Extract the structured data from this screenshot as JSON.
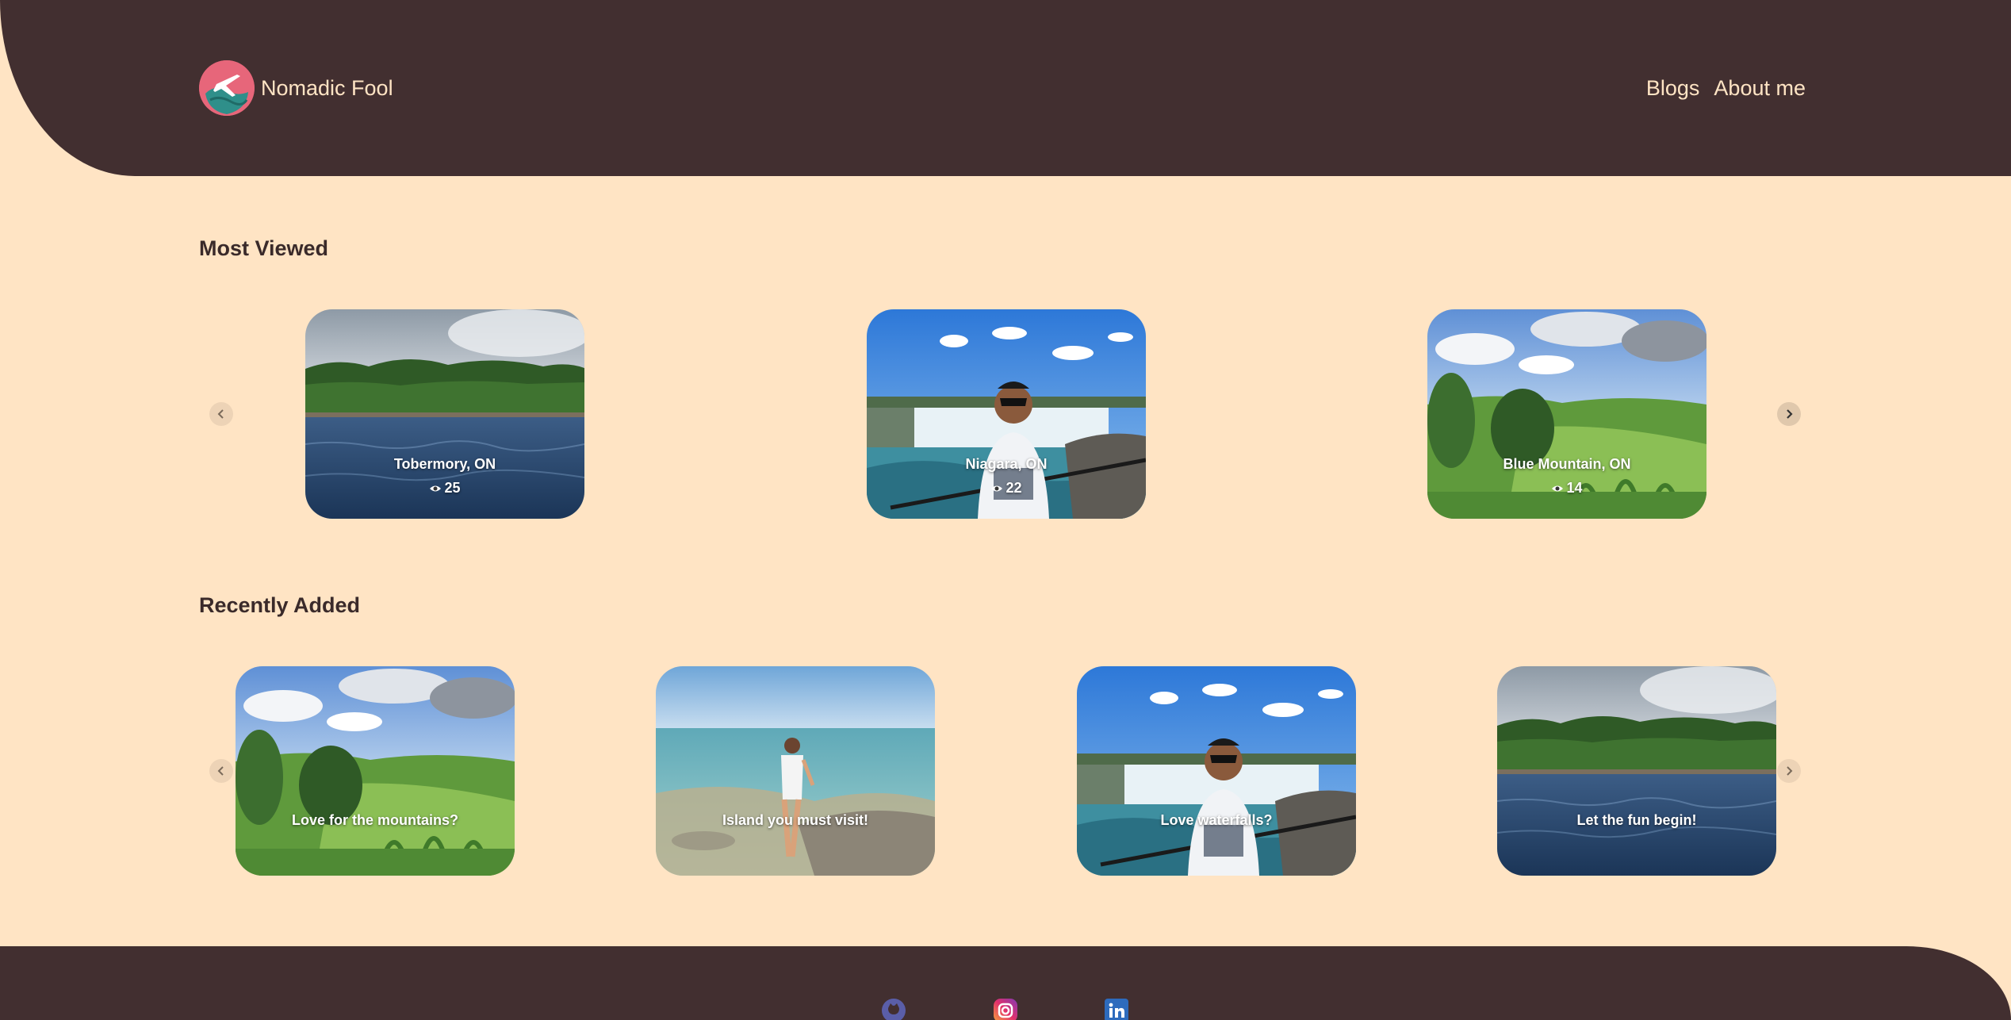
{
  "header": {
    "brand": "Nomadic Fool",
    "nav": [
      "Blogs",
      "About me"
    ]
  },
  "most_viewed": {
    "title": "Most Viewed",
    "cards": [
      {
        "label": "Tobermory, ON",
        "views": "25",
        "scene": "lake"
      },
      {
        "label": "Niagara, ON",
        "views": "22",
        "scene": "falls"
      },
      {
        "label": "Blue Mountain, ON",
        "views": "14",
        "scene": "mountain"
      }
    ]
  },
  "recently_added": {
    "title": "Recently Added",
    "cards": [
      {
        "label": "Love for the mountains?",
        "scene": "mountain"
      },
      {
        "label": "Island you must visit!",
        "scene": "island"
      },
      {
        "label": "Love waterfalls?",
        "scene": "falls"
      },
      {
        "label": "Let the fun begin!",
        "scene": "lake"
      }
    ]
  },
  "footer": {
    "social": [
      "github-icon",
      "instagram-icon",
      "linkedin-icon"
    ]
  },
  "colors": {
    "background": "#ffe4c4",
    "header": "#422f30",
    "nav_text": "#ffe4c4"
  }
}
